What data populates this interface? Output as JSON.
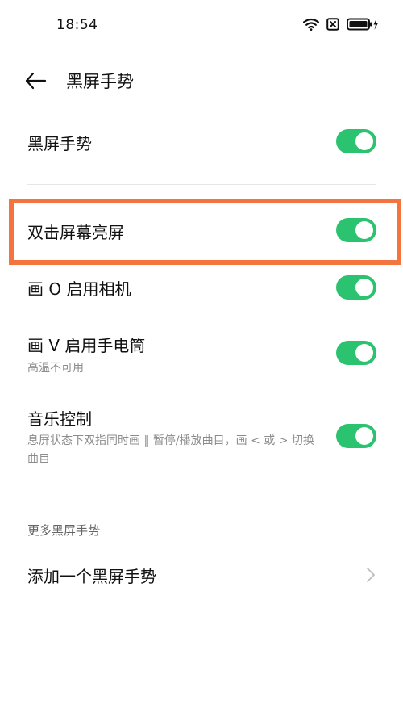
{
  "status_bar": {
    "time": "18:54",
    "icons": [
      "wifi-icon",
      "sim-off-icon",
      "battery-charging-icon"
    ]
  },
  "header": {
    "back_icon": "arrow-left-icon",
    "title": "黑屏手势"
  },
  "settings": {
    "main_toggle": {
      "label": "黑屏手势",
      "enabled": true
    },
    "double_tap": {
      "label": "双击屏幕亮屏",
      "enabled": true
    },
    "draw_o": {
      "label": "画 O 启用相机",
      "enabled": true
    },
    "draw_v": {
      "label": "画 V 启用手电筒",
      "description": "高温不可用",
      "enabled": true
    },
    "music": {
      "label": "音乐控制",
      "description": "息屏状态下双指同时画 ‖ 暂停/播放曲目，画 < 或 > 切换曲目",
      "enabled": true
    }
  },
  "more_section": {
    "header": "更多黑屏手势",
    "add_item": {
      "label": "添加一个黑屏手势",
      "icon": "chevron-right-icon"
    }
  },
  "colors": {
    "toggle_on": "#2bc36f",
    "highlight": "#f4743f",
    "divider": "#e6e6e6",
    "secondary_text": "#8c8c8c"
  }
}
